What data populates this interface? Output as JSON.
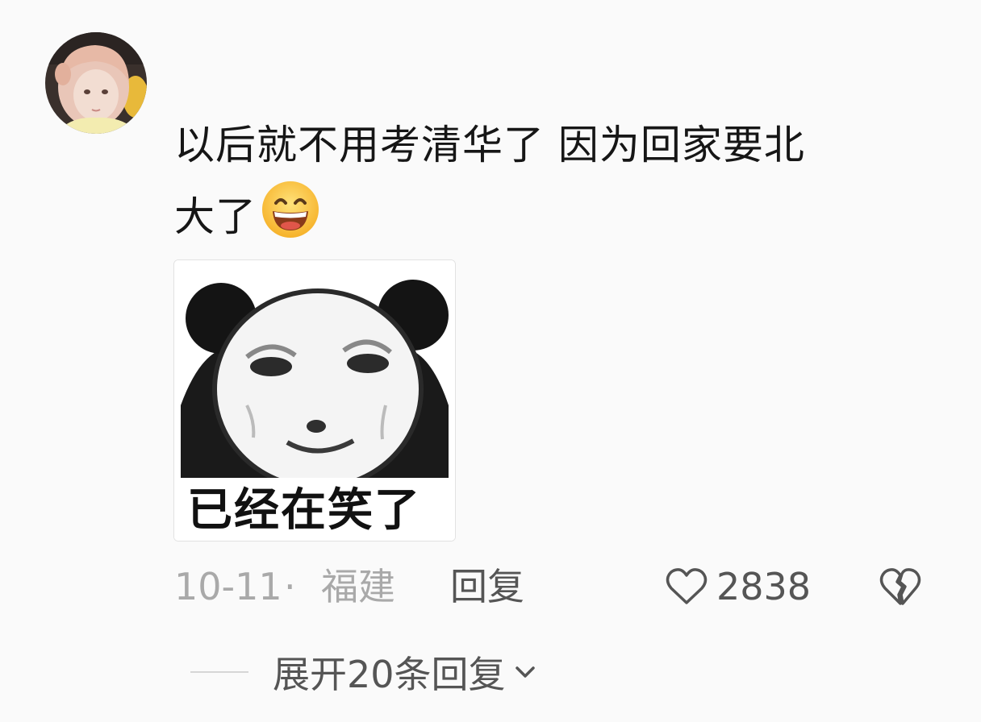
{
  "comment": {
    "text_line1": "以后就不用考清华了  因为回家要北",
    "text_line2": "大了",
    "emoji": "grinning-squinting-face-emoji",
    "sticker": {
      "caption": "已经在笑了",
      "image": "panda-face-meme"
    },
    "meta": {
      "date": "10-11",
      "separator": "·",
      "location": "福建",
      "reply_label": "回复",
      "like_count": "2838"
    },
    "expand_label": "展开20条回复"
  },
  "colors": {
    "text": "#161616",
    "meta_gray": "#a9a9a9",
    "action_gray": "#555555",
    "background": "#fafafa"
  }
}
